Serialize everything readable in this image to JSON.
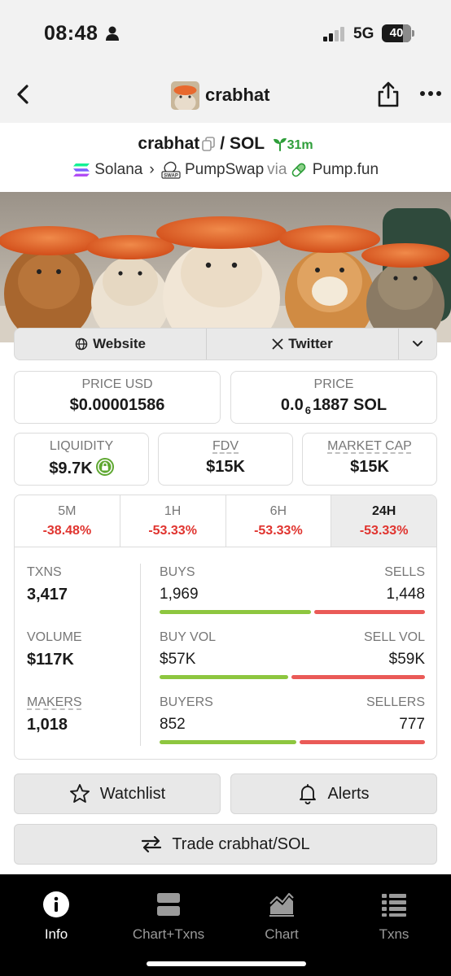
{
  "status": {
    "time": "08:48",
    "network": "5G",
    "battery": "40"
  },
  "nav": {
    "title": "crabhat"
  },
  "pair": {
    "base": "crabhat",
    "separator": "/",
    "quote": "SOL",
    "age": "31m"
  },
  "chain": {
    "name": "Solana",
    "dex": "PumpSwap",
    "dex_badge": "SWAP",
    "via": "via",
    "launchpad": "Pump.fun"
  },
  "links": {
    "website": "Website",
    "twitter": "Twitter"
  },
  "price_usd": {
    "label": "PRICE USD",
    "value": "$0.00001586"
  },
  "price": {
    "label": "PRICE",
    "prefix": "0.0",
    "zeros": "6",
    "suffix": "1887 SOL"
  },
  "liquidity": {
    "label": "LIQUIDITY",
    "value": "$9.7K"
  },
  "fdv": {
    "label": "FDV",
    "value": "$15K"
  },
  "market_cap": {
    "label": "MARKET CAP",
    "value": "$15K"
  },
  "timeframes": [
    {
      "label": "5M",
      "change": "-38.48%"
    },
    {
      "label": "1H",
      "change": "-53.33%"
    },
    {
      "label": "6H",
      "change": "-53.33%"
    },
    {
      "label": "24H",
      "change": "-53.33%"
    }
  ],
  "metrics": {
    "txns": {
      "label": "TXNS",
      "value": "3,417"
    },
    "volume": {
      "label": "VOLUME",
      "value": "$117K"
    },
    "makers": {
      "label": "MAKERS",
      "value": "1,018"
    },
    "buys": {
      "label": "BUYS",
      "value": "1,969",
      "share": 0.576
    },
    "sells": {
      "label": "SELLS",
      "value": "1,448"
    },
    "buy_vol": {
      "label": "BUY VOL",
      "value": "$57K",
      "share": 0.49
    },
    "sell_vol": {
      "label": "SELL VOL",
      "value": "$59K"
    },
    "buyers": {
      "label": "BUYERS",
      "value": "852",
      "share": 0.523
    },
    "sellers": {
      "label": "SELLERS",
      "value": "777"
    }
  },
  "actions": {
    "watchlist": "Watchlist",
    "alerts": "Alerts",
    "trade": "Trade crabhat/SOL"
  },
  "tabs": [
    {
      "label": "Info",
      "icon": "info-icon",
      "active": true
    },
    {
      "label": "Chart+Txns",
      "icon": "chart-txns-icon",
      "active": false
    },
    {
      "label": "Chart",
      "icon": "area-chart-icon",
      "active": false
    },
    {
      "label": "Txns",
      "icon": "list-icon",
      "active": false
    }
  ],
  "colors": {
    "positive": "#8dc63f",
    "negative": "#ea5a57",
    "red_text": "#e0342f",
    "age_green": "#2e9e3a"
  }
}
